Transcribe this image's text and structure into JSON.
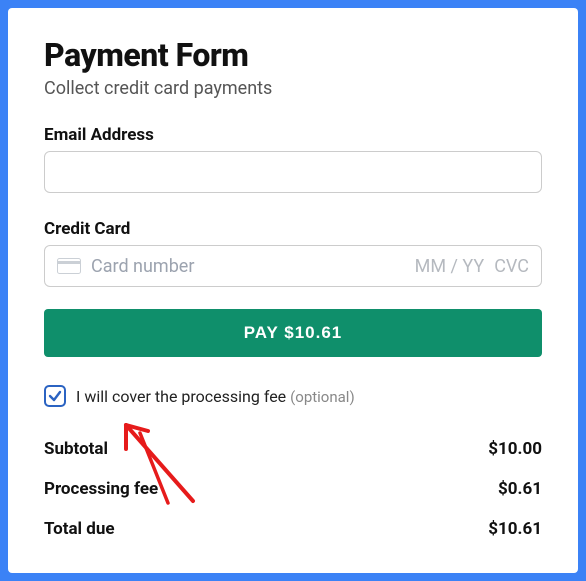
{
  "header": {
    "title": "Payment Form",
    "subtitle": "Collect credit card payments"
  },
  "email": {
    "label": "Email Address"
  },
  "credit_card": {
    "label": "Credit Card",
    "number_placeholder": "Card number",
    "exp_placeholder": "MM / YY",
    "cvc_placeholder": "CVC"
  },
  "pay_button": {
    "label": "PAY $10.61"
  },
  "fee_checkbox": {
    "label": "I will cover the processing fee",
    "optional_text": "(optional)"
  },
  "totals": {
    "subtotal_label": "Subtotal",
    "subtotal_amount": "$10.00",
    "fee_label": "Processing fee",
    "fee_amount": "$0.61",
    "total_label": "Total due",
    "total_amount": "$10.61"
  }
}
